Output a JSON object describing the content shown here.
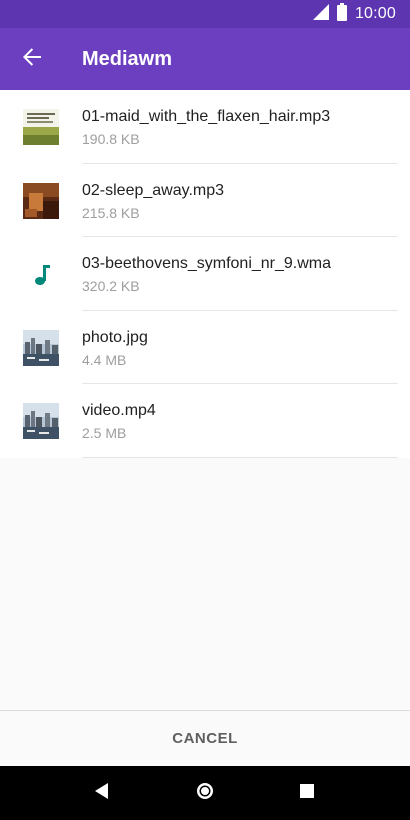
{
  "status_bar": {
    "time": "10:00",
    "icons": [
      "signal-icon",
      "battery-icon"
    ]
  },
  "app_bar": {
    "title": "Mediawm",
    "back_icon": "arrow-back-icon"
  },
  "files": [
    {
      "name": "01-maid_with_the_flaxen_hair.mp3",
      "size": "190.8 KB",
      "thumbnail": "album-art-green"
    },
    {
      "name": "02-sleep_away.mp3",
      "size": "215.8 KB",
      "thumbnail": "album-art-brown"
    },
    {
      "name": "03-beethovens_symfoni_nr_9.wma",
      "size": "320.2 KB",
      "thumbnail": "music-note-icon"
    },
    {
      "name": "photo.jpg",
      "size": "4.4 MB",
      "thumbnail": "harbor-photo"
    },
    {
      "name": "video.mp4",
      "size": "2.5 MB",
      "thumbnail": "harbor-photo"
    }
  ],
  "footer": {
    "cancel_label": "CANCEL"
  },
  "colors": {
    "app_bar": "#6b3fbf",
    "status_bar": "#5e35b1",
    "music_note": "#00897b"
  },
  "nav_bar": {
    "icons": [
      "back-triangle-icon",
      "home-circle-icon",
      "recents-square-icon"
    ]
  }
}
